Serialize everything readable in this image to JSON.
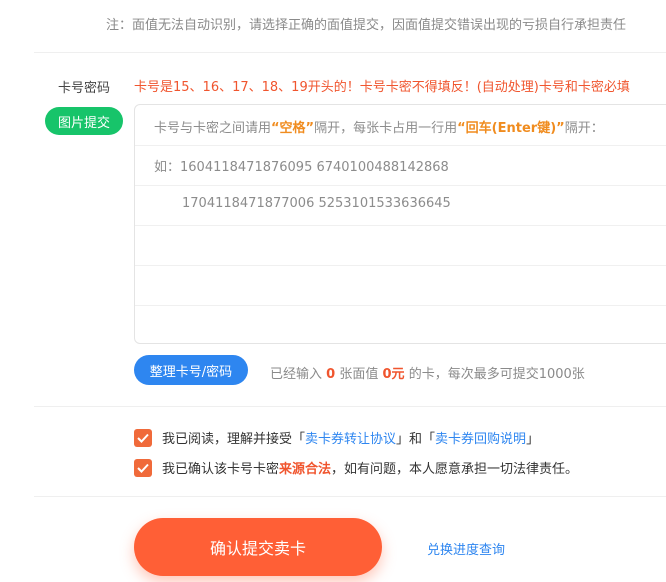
{
  "notice": "注：面值无法自动识别，请选择正确的面值提交，因面值提交错误出现的亏损自行承担责任",
  "card_form": {
    "label": "卡号密码",
    "warning": "卡号是15、16、17、18、19开头的！卡号卡密不得填反！(自动处理)卡号和卡密必填",
    "image_submit_label": "图片提交",
    "hint": {
      "part1": "卡号与卡密之间请用",
      "em1": "“空格”",
      "part2": "隔开，每张卡占用一行用",
      "em2": "“回车(Enter键)”",
      "part3": "隔开："
    },
    "example_line1": "如：1604118471876095 6740100488142868",
    "example_line2": "1704118471877006 5253101533636645"
  },
  "toolbar": {
    "sort_label": "整理卡号/密码",
    "count_prefix": "已经输入",
    "count_cards": "0",
    "count_mid": "张面值",
    "count_value": "0元",
    "count_suffix": "的卡，每次最多可提交1000张"
  },
  "agreements": {
    "first": {
      "prefix": "我已阅读，理解并接受「",
      "link1": "卖卡券转让协议",
      "mid": "」和「",
      "link2": "卖卡券回购说明",
      "suffix": "」"
    },
    "second": {
      "prefix": "我已确认该卡号卡密",
      "emphasis": "来源合法",
      "suffix": "，如有问题，本人愿意承担一切法律责任。"
    }
  },
  "actions": {
    "submit_label": "确认提交卖卡",
    "progress_link": "兑换进度查询"
  },
  "colors": {
    "accent_orange": "#ff5f36",
    "warning_red": "#f0552e",
    "link_blue": "#2e86f0",
    "green": "#17c46a"
  }
}
